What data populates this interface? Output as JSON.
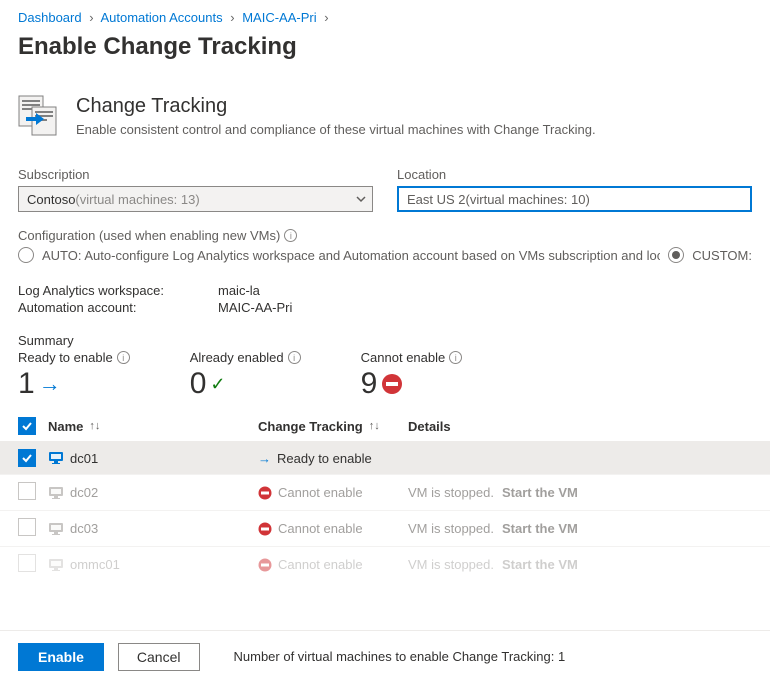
{
  "breadcrumb": [
    {
      "label": "Dashboard"
    },
    {
      "label": "Automation Accounts"
    },
    {
      "label": "MAIC-AA-Pri"
    }
  ],
  "page_title": "Enable Change Tracking",
  "hero": {
    "title": "Change Tracking",
    "subtitle": "Enable consistent control and compliance of these virtual machines with Change Tracking."
  },
  "subscription": {
    "label": "Subscription",
    "value": "Contoso",
    "suffix": " (virtual machines: 13)"
  },
  "location": {
    "label": "Location",
    "value": "East US 2",
    "suffix": " (virtual machines: 10)"
  },
  "config": {
    "label": "Configuration (used when enabling new VMs)",
    "auto_label": "AUTO: Auto-configure Log Analytics workspace and Automation account based on VMs subscription and location",
    "custom_label": "CUSTOM:"
  },
  "workspace": {
    "law_label": "Log Analytics workspace:",
    "law_value": "maic-la",
    "aa_label": "Automation account:",
    "aa_value": "MAIC-AA-Pri"
  },
  "summary": {
    "label": "Summary",
    "ready_label": "Ready to enable",
    "ready_value": "1",
    "already_label": "Already enabled",
    "already_value": "0",
    "cannot_label": "Cannot enable",
    "cannot_value": "9"
  },
  "table": {
    "col_name": "Name",
    "col_ct": "Change Tracking",
    "col_details": "Details",
    "rows": [
      {
        "name": "dc01",
        "status": "ready",
        "status_label": "Ready to enable",
        "details": "",
        "action": "",
        "checked": true,
        "enabled": true
      },
      {
        "name": "dc02",
        "status": "cannot",
        "status_label": "Cannot enable",
        "details": "VM is stopped.",
        "action": "Start the VM",
        "checked": false,
        "enabled": false
      },
      {
        "name": "dc03",
        "status": "cannot",
        "status_label": "Cannot enable",
        "details": "VM is stopped.",
        "action": "Start the VM",
        "checked": false,
        "enabled": false
      },
      {
        "name": "ommc01",
        "status": "cannot",
        "status_label": "Cannot enable",
        "details": "VM is stopped.",
        "action": "Start the VM",
        "checked": false,
        "enabled": false
      }
    ]
  },
  "footer": {
    "enable_label": "Enable",
    "cancel_label": "Cancel",
    "count_text": "Number of virtual machines to enable Change Tracking: 1"
  }
}
